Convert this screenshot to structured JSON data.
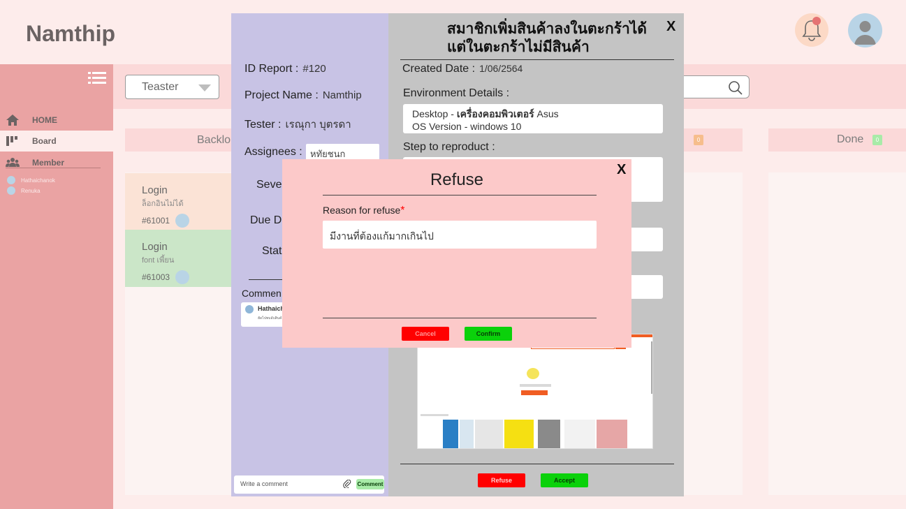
{
  "app": {
    "brand": "Namthip"
  },
  "sidebar": {
    "items": [
      {
        "label": "HOME",
        "icon": "home-icon"
      },
      {
        "label": "Board",
        "icon": "board-icon"
      },
      {
        "label": "Member",
        "icon": "members-icon"
      }
    ],
    "members": [
      "Hathaichanok",
      "Renuka"
    ]
  },
  "toolbar": {
    "role_select": "Teaster"
  },
  "board": {
    "columns": [
      {
        "title": "Backlo"
      },
      {
        "title": "Done",
        "count": "0"
      }
    ],
    "hidden_column_count": "0",
    "cards": [
      {
        "title": "Login",
        "subtitle": "ล็อกอินไม่ได้",
        "id": "#61001"
      },
      {
        "title": "Login",
        "subtitle": "font เพี้ยน",
        "id": "#61003"
      }
    ]
  },
  "report": {
    "title": "สมาชิกเพิ่มสินค้าลงในตะกร้าได้ แต่ในตะกร้าไม่มีสินค้า",
    "close": "X",
    "id_label": "ID Report :",
    "id_value": "#120",
    "project_label": "Project Name :",
    "project_value": "Namthip",
    "tester_label": "Tester :",
    "tester_value": "เรณุกา บุตรดา",
    "assignees_label": "Assignees :",
    "assignees_value": "หทัยชนก",
    "severity_label": "Sever",
    "due_label": "Due Da",
    "status_label": "Stat",
    "comment_label": "Commen",
    "comment_author": "Hathaich",
    "comment_text": "ฮัดไปพบอับสินค้",
    "comment_placeholder": "Write a comment",
    "comment_button": "Comment",
    "created_label": "Created Date :",
    "created_value": "1/06/2564",
    "env_label": "Environment Details :",
    "env_line1_prefix": "Desktop - ",
    "env_line1_bold": "เครื่องคอมพิวเตอร์",
    "env_line1_suffix": " Asus",
    "env_line2": "OS Version - windows 10",
    "steps_label": "Step to reproduct :",
    "refuse_button": "Refuse",
    "accept_button": "Accept"
  },
  "refuse_dialog": {
    "title": "Refuse",
    "close": "X",
    "reason_label": "Reason for refuse",
    "required_mark": "*",
    "reason_value": "มีงานที่ต้องแก้มากเกินไป",
    "cancel_button": "Cancel",
    "confirm_button": "Confirm"
  }
}
